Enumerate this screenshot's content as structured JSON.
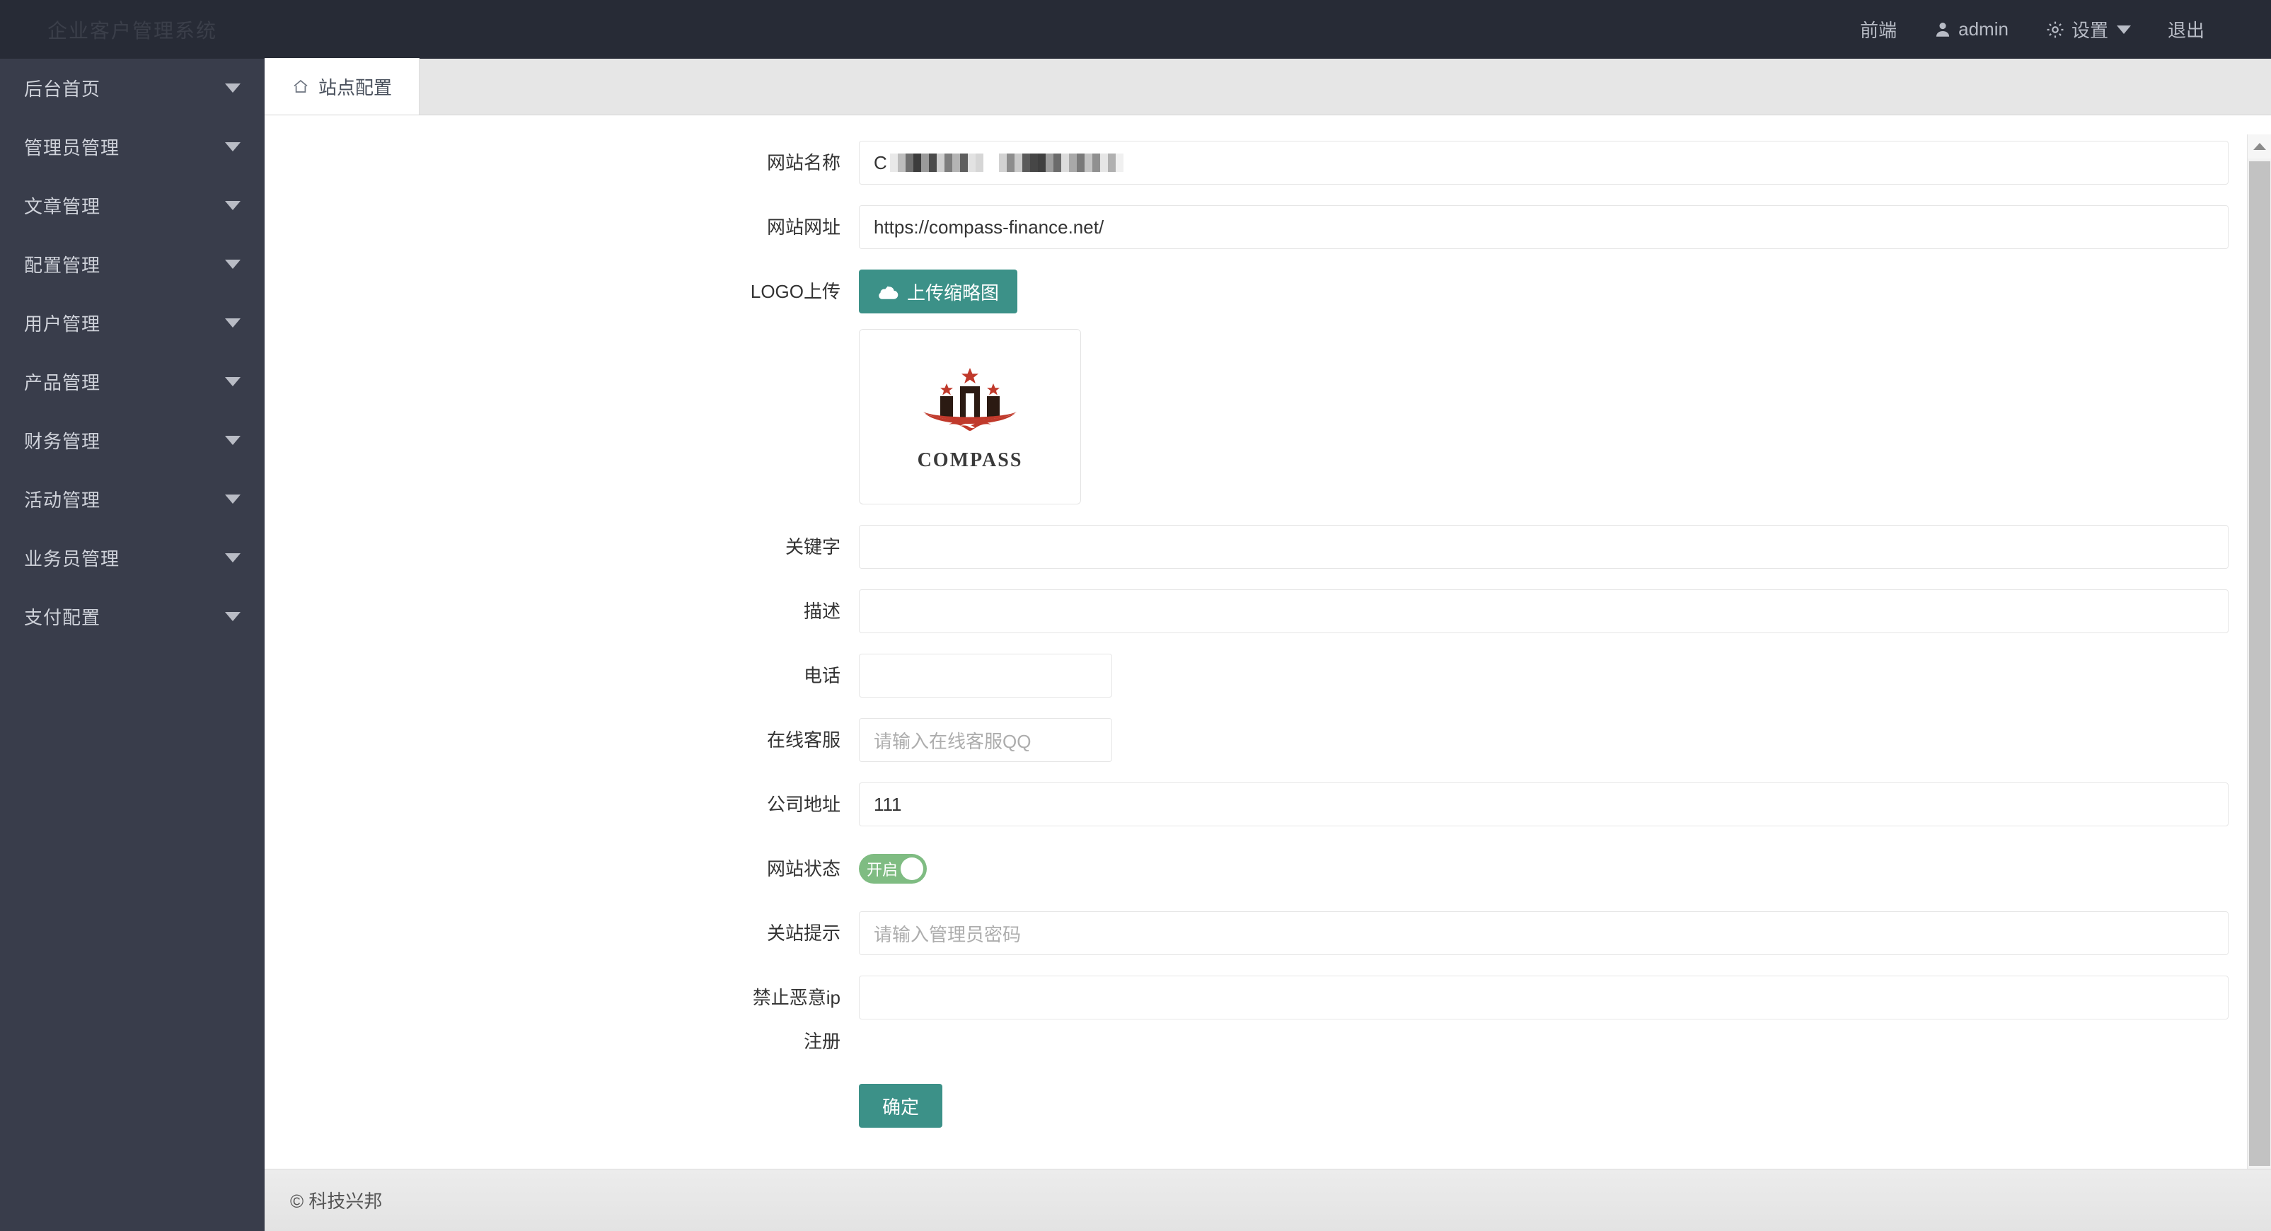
{
  "header": {
    "logo_text": "企业客户管理系统",
    "nav": [
      {
        "label": "前端",
        "icon": ""
      },
      {
        "label": "admin",
        "icon": "user-icon"
      },
      {
        "label": "设置",
        "icon": "gear-icon"
      },
      {
        "label": "退出",
        "icon": ""
      }
    ]
  },
  "sidebar": {
    "items": [
      {
        "label": "后台首页"
      },
      {
        "label": "管理员管理"
      },
      {
        "label": "文章管理"
      },
      {
        "label": "配置管理"
      },
      {
        "label": "用户管理"
      },
      {
        "label": "产品管理"
      },
      {
        "label": "财务管理"
      },
      {
        "label": "活动管理"
      },
      {
        "label": "业务员管理"
      },
      {
        "label": "支付配置"
      }
    ]
  },
  "tabs": [
    {
      "label": "站点配置",
      "icon": "home-icon",
      "active": true
    }
  ],
  "form": {
    "site_name": {
      "label": "网站名称",
      "value": "C",
      "redacted": true,
      "placeholder": ""
    },
    "site_url": {
      "label": "网站网址",
      "value": "https://compass-finance.net/",
      "placeholder": ""
    },
    "logo_upload": {
      "label": "LOGO上传",
      "button_label": "上传缩略图",
      "thumbnail_alt": "COMPASS",
      "thumbnail_word": "COMPASS"
    },
    "keywords": {
      "label": "关键字",
      "value": "",
      "placeholder": ""
    },
    "description": {
      "label": "描述",
      "value": "",
      "placeholder": ""
    },
    "phone": {
      "label": "电话",
      "value": "",
      "placeholder": ""
    },
    "online_service": {
      "label": "在线客服",
      "value": "",
      "placeholder": "请输入在线客服QQ"
    },
    "company_address": {
      "label": "公司地址",
      "value": "111",
      "placeholder": ""
    },
    "site_status": {
      "label": "网站状态",
      "toggle_text": "开启",
      "on": true
    },
    "close_tip": {
      "label": "关站提示",
      "value": "",
      "placeholder": "请输入管理员密码"
    },
    "block_ip": {
      "label": "禁止恶意ip\n注册",
      "value": "",
      "placeholder": ""
    },
    "submit": {
      "label": "确定"
    }
  },
  "footer": {
    "text": "© 科技兴邦"
  },
  "colors": {
    "header_bg": "#272b36",
    "sidebar_bg": "#393d4b",
    "accent_teal": "#3c9188",
    "toggle_green": "#7fbc82"
  }
}
